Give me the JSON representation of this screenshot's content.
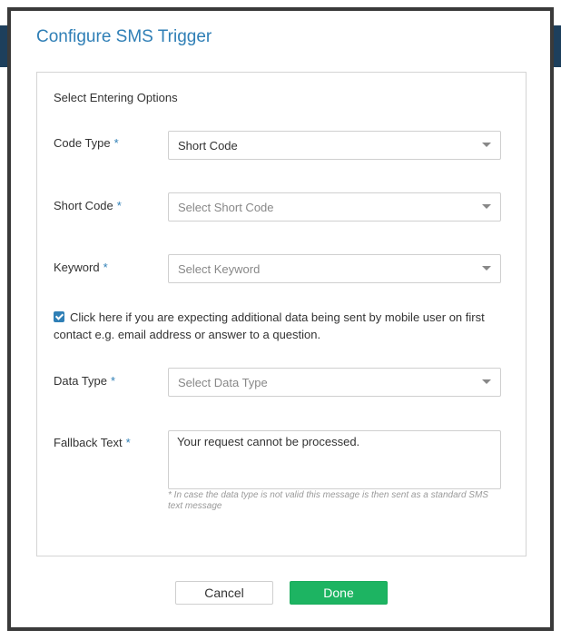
{
  "modal": {
    "title": "Configure SMS Trigger"
  },
  "panel": {
    "section_heading": "Select Entering Options",
    "required_marker": "*",
    "code_type": {
      "label": "Code Type",
      "value": "Short Code"
    },
    "short_code": {
      "label": "Short Code",
      "placeholder": "Select Short Code"
    },
    "keyword": {
      "label": "Keyword",
      "placeholder": "Select Keyword"
    },
    "additional_data": {
      "checked": true,
      "text": "Click here if you are expecting additional data being sent by mobile user on first contact e.g. email address or answer to a question."
    },
    "data_type": {
      "label": "Data Type",
      "placeholder": "Select Data Type"
    },
    "fallback_text": {
      "label": "Fallback Text",
      "value": "Your request cannot be processed.",
      "hint": "* In case the data type is not valid this message is then sent as a standard SMS text message"
    }
  },
  "footer": {
    "cancel_label": "Cancel",
    "done_label": "Done"
  },
  "colors": {
    "accent": "#2f7fb6",
    "done_button": "#1db462",
    "modal_border": "#3a3a3a"
  }
}
